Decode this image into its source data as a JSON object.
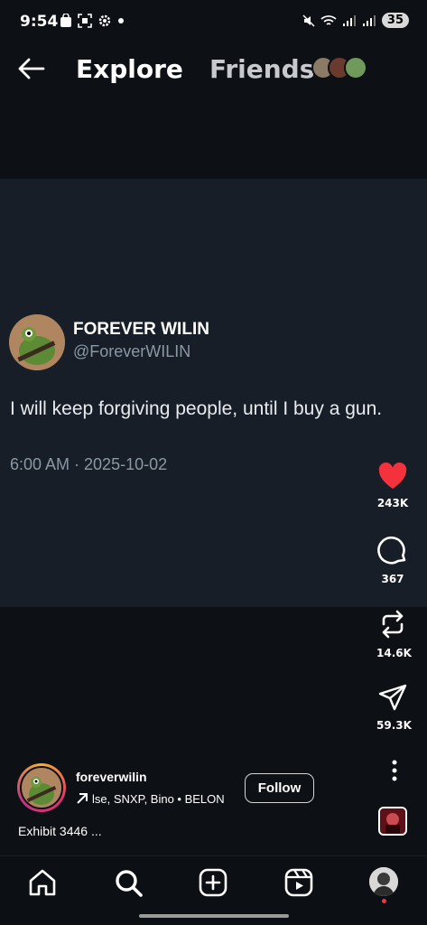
{
  "status_bar": {
    "time": "9:54",
    "battery": "35"
  },
  "top_nav": {
    "explore_label": "Explore",
    "friends_label": "Friends"
  },
  "post": {
    "author_name": "FOREVER WILIN",
    "author_handle": "@ForeverWILIN",
    "text": "I will keep forgiving people, until I buy a gun.",
    "timestamp": "6:00 AM · 2025-10-02"
  },
  "actions": {
    "likes": "243K",
    "comments": "367",
    "reposts": "14.6K",
    "shares": "59.3K"
  },
  "reel": {
    "username": "foreverwilin",
    "music": "lse, SNXP, Bino • BELON",
    "follow_label": "Follow",
    "caption": "Exhibit 3446 ..."
  },
  "colors": {
    "like": "#f4323e",
    "post_card_bg": "#171e27",
    "secondary_text": "#8b98a5"
  }
}
